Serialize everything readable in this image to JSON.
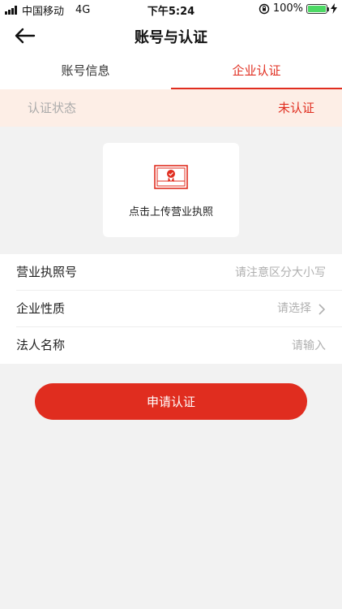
{
  "status_bar": {
    "carrier": "中国移动",
    "network": "4G",
    "time": "下午5:24",
    "battery": "100%"
  },
  "nav": {
    "title": "账号与认证"
  },
  "tabs": [
    {
      "label": "账号信息",
      "active": false
    },
    {
      "label": "企业认证",
      "active": true
    }
  ],
  "status_row": {
    "label": "认证状态",
    "value": "未认证"
  },
  "upload": {
    "label": "点击上传营业执照"
  },
  "form": {
    "license": {
      "label": "营业执照号",
      "placeholder": "请注意区分大小写"
    },
    "nature": {
      "label": "企业性质",
      "placeholder": "请选择"
    },
    "legal": {
      "label": "法人名称",
      "placeholder": "请输入"
    }
  },
  "submit": {
    "label": "申请认证"
  },
  "colors": {
    "accent": "#e02d1f",
    "status_bg": "#fdeee6"
  }
}
